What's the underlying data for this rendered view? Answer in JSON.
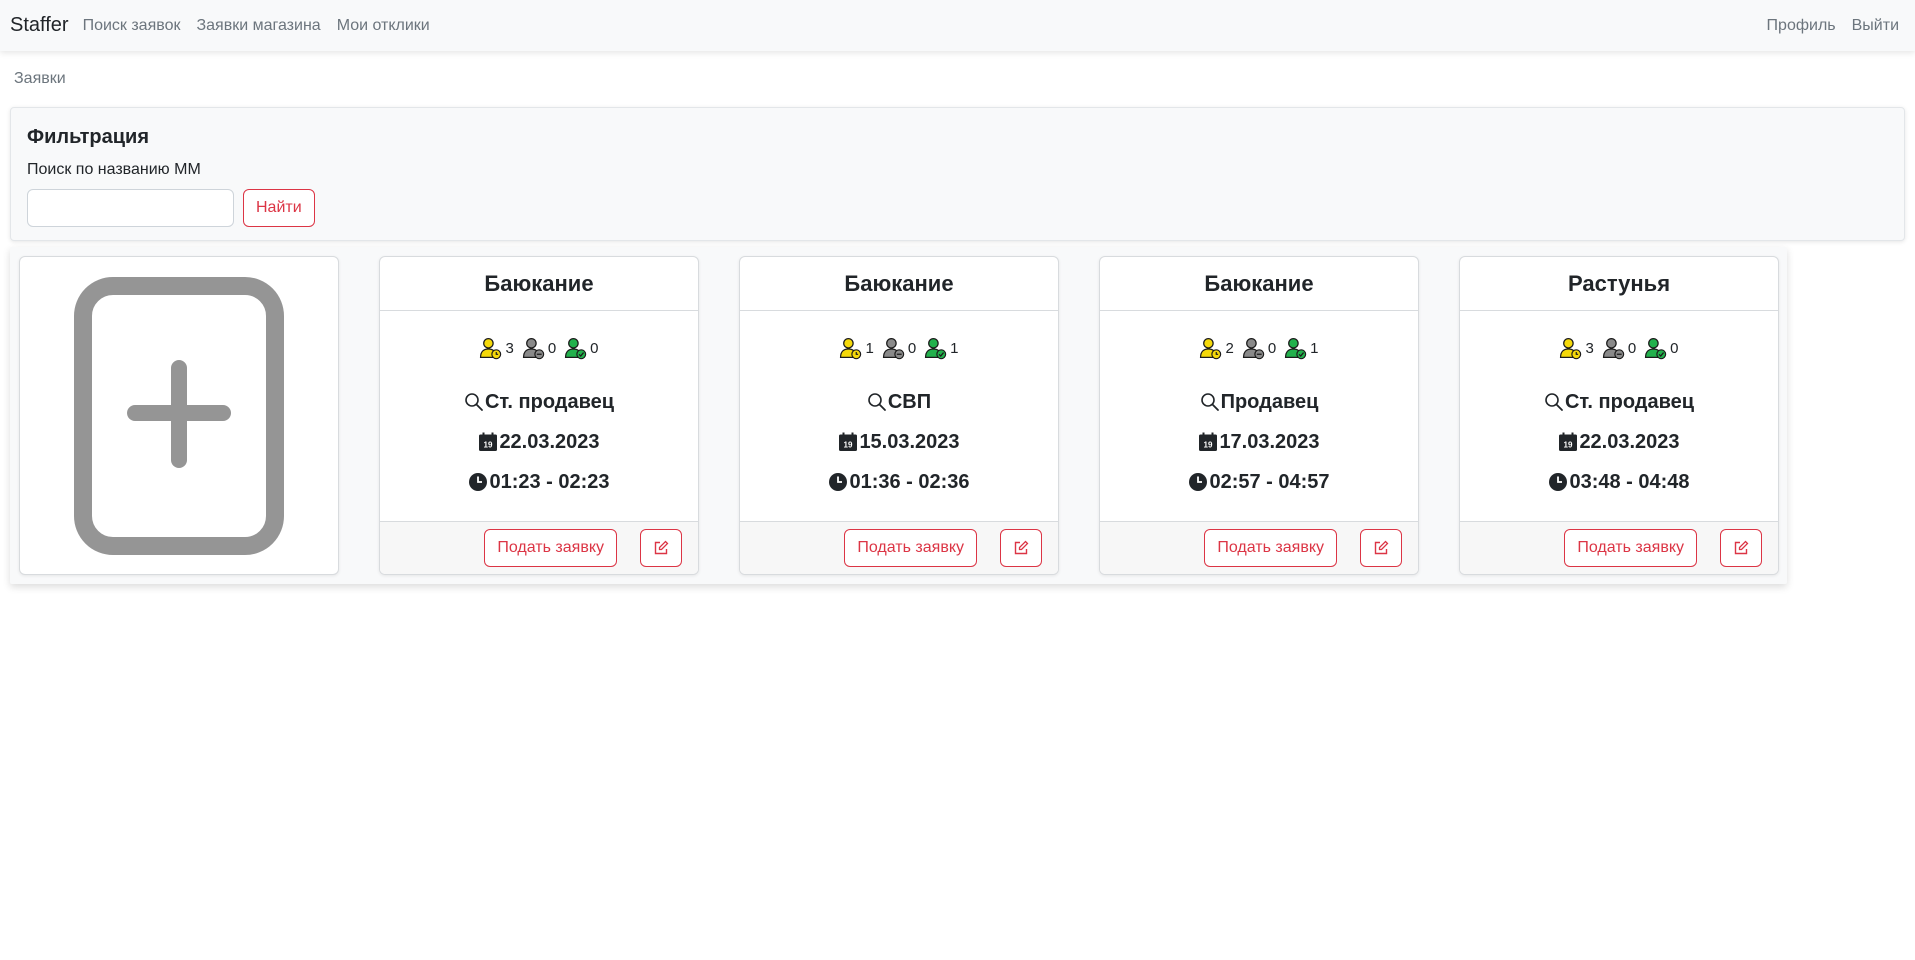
{
  "navbar": {
    "brand": "Staffer",
    "links": [
      "Поиск заявок",
      "Заявки магазина",
      "Мои отклики"
    ],
    "profile": "Профиль",
    "logout": "Выйти"
  },
  "breadcrumb": "Заявки",
  "filter": {
    "title": "Фильтрация",
    "label": "Поиск по названию ММ",
    "input_value": "",
    "button": "Найти"
  },
  "add_card_icon": "add-document-icon",
  "colors": {
    "accent": "#dc3545",
    "pending": "#f5d90a",
    "neutral": "#8a8a8a",
    "approved": "#22b14c",
    "add_icon": "#959595"
  },
  "cards": [
    {
      "title": "Баюкание",
      "pending": "3",
      "neutral": "0",
      "approved": "0",
      "position": "Ст. продавец",
      "date": "22.03.2023",
      "time": "01:23 - 02:23",
      "apply": "Подать заявку"
    },
    {
      "title": "Баюкание",
      "pending": "1",
      "neutral": "0",
      "approved": "1",
      "position": "СВП",
      "date": "15.03.2023",
      "time": "01:36 - 02:36",
      "apply": "Подать заявку"
    },
    {
      "title": "Баюкание",
      "pending": "2",
      "neutral": "0",
      "approved": "1",
      "position": "Продавец",
      "date": "17.03.2023",
      "time": "02:57 - 04:57",
      "apply": "Подать заявку"
    },
    {
      "title": "Растунья",
      "pending": "3",
      "neutral": "0",
      "approved": "0",
      "position": "Ст. продавец",
      "date": "22.03.2023",
      "time": "03:48 - 04:48",
      "apply": "Подать заявку"
    }
  ]
}
